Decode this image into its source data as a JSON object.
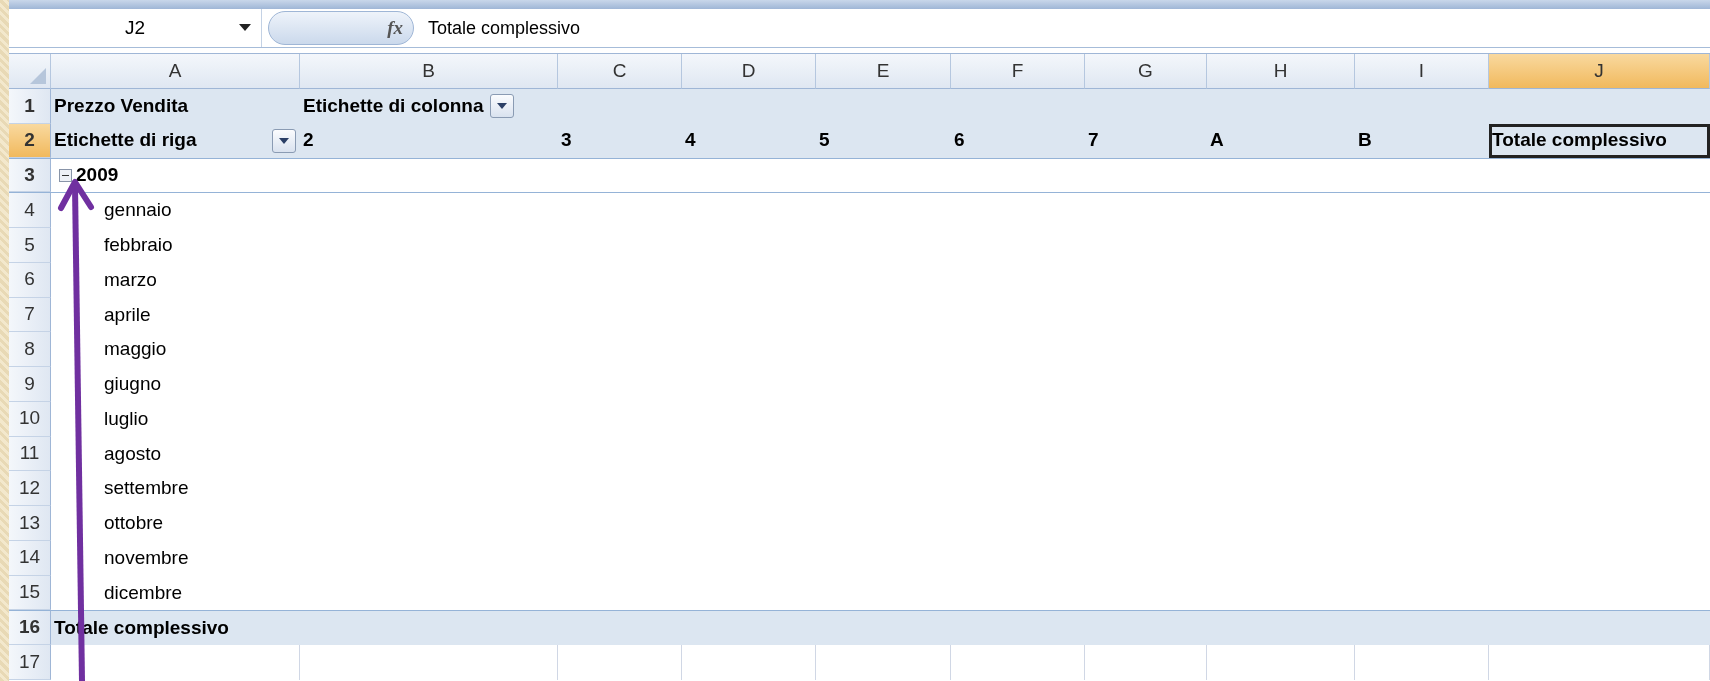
{
  "formula_bar": {
    "name_box": "J2",
    "function_symbol": "fx",
    "formula": "Totale complessivo"
  },
  "columns": [
    {
      "label": "A",
      "selected": false
    },
    {
      "label": "B",
      "selected": false
    },
    {
      "label": "C",
      "selected": false
    },
    {
      "label": "D",
      "selected": false
    },
    {
      "label": "E",
      "selected": false
    },
    {
      "label": "F",
      "selected": false
    },
    {
      "label": "G",
      "selected": false
    },
    {
      "label": "H",
      "selected": false
    },
    {
      "label": "I",
      "selected": false
    },
    {
      "label": "J",
      "selected": true
    }
  ],
  "rows": [
    {
      "number": "1",
      "selected": false,
      "kind": "header",
      "cells": [
        {
          "text": "Prezzo Vendita"
        },
        {
          "text": "Etichette di colonna",
          "filter_button": true
        }
      ]
    },
    {
      "number": "2",
      "selected": true,
      "kind": "header",
      "cells": [
        {
          "text": "Etichette di riga",
          "filter_button": true
        },
        {
          "text": "2"
        },
        {
          "text": "3"
        },
        {
          "text": "4"
        },
        {
          "text": "5"
        },
        {
          "text": "6"
        },
        {
          "text": "7"
        },
        {
          "text": "A"
        },
        {
          "text": "B"
        },
        {
          "text": "Totale complessivo",
          "selected": true
        }
      ]
    },
    {
      "number": "3",
      "selected": false,
      "kind": "year",
      "cells": [
        {
          "text": "2009",
          "expanded": true
        }
      ]
    },
    {
      "number": "4",
      "selected": false,
      "kind": "month",
      "cells": [
        {
          "text": "gennaio"
        }
      ]
    },
    {
      "number": "5",
      "selected": false,
      "kind": "month",
      "cells": [
        {
          "text": "febbraio"
        }
      ]
    },
    {
      "number": "6",
      "selected": false,
      "kind": "month",
      "cells": [
        {
          "text": "marzo"
        }
      ]
    },
    {
      "number": "7",
      "selected": false,
      "kind": "month",
      "cells": [
        {
          "text": "aprile"
        }
      ]
    },
    {
      "number": "8",
      "selected": false,
      "kind": "month",
      "cells": [
        {
          "text": "maggio"
        }
      ]
    },
    {
      "number": "9",
      "selected": false,
      "kind": "month",
      "cells": [
        {
          "text": "giugno"
        }
      ]
    },
    {
      "number": "10",
      "selected": false,
      "kind": "month",
      "cells": [
        {
          "text": "luglio"
        }
      ]
    },
    {
      "number": "11",
      "selected": false,
      "kind": "month",
      "cells": [
        {
          "text": "agosto"
        }
      ]
    },
    {
      "number": "12",
      "selected": false,
      "kind": "month",
      "cells": [
        {
          "text": "settembre"
        }
      ]
    },
    {
      "number": "13",
      "selected": false,
      "kind": "month",
      "cells": [
        {
          "text": "ottobre"
        }
      ]
    },
    {
      "number": "14",
      "selected": false,
      "kind": "month",
      "cells": [
        {
          "text": "novembre"
        }
      ]
    },
    {
      "number": "15",
      "selected": false,
      "kind": "month",
      "cells": [
        {
          "text": "dicembre"
        }
      ]
    },
    {
      "number": "16",
      "selected": false,
      "kind": "total",
      "cells": [
        {
          "text": "Totale complessivo"
        }
      ]
    },
    {
      "number": "17",
      "selected": false,
      "kind": "empty",
      "cells": []
    }
  ]
}
